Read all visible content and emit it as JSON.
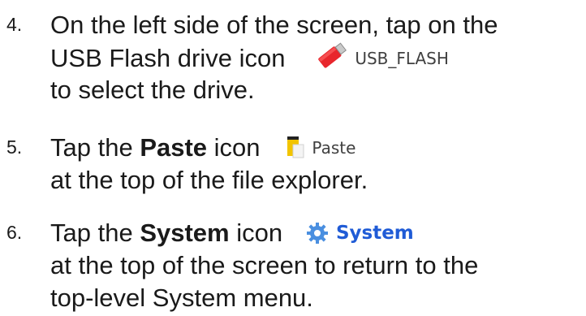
{
  "steps": [
    {
      "number": "4.",
      "line1": "On the left side of the screen, tap on the",
      "line2_prefix": "USB Flash drive icon",
      "icon": "usb-flash-drive-icon",
      "icon_label": "USB_FLASH",
      "line3": "to select the drive."
    },
    {
      "number": "5.",
      "prefix": "Tap the ",
      "bold": "Paste",
      "suffix": " icon",
      "icon": "paste-icon",
      "icon_label": "Paste",
      "line2": "at the top of the file explorer."
    },
    {
      "number": "6.",
      "prefix": "Tap the ",
      "bold": "System",
      "suffix": " icon",
      "icon": "system-gear-icon",
      "icon_label": "System",
      "line2": "at the top of the screen to return to the",
      "line3": "top-level System menu."
    }
  ],
  "colors": {
    "text": "#1a1a1a",
    "usb_red": "#e8262c",
    "system_blue": "#1f5bd6",
    "paste_yellow": "#f2c400"
  }
}
